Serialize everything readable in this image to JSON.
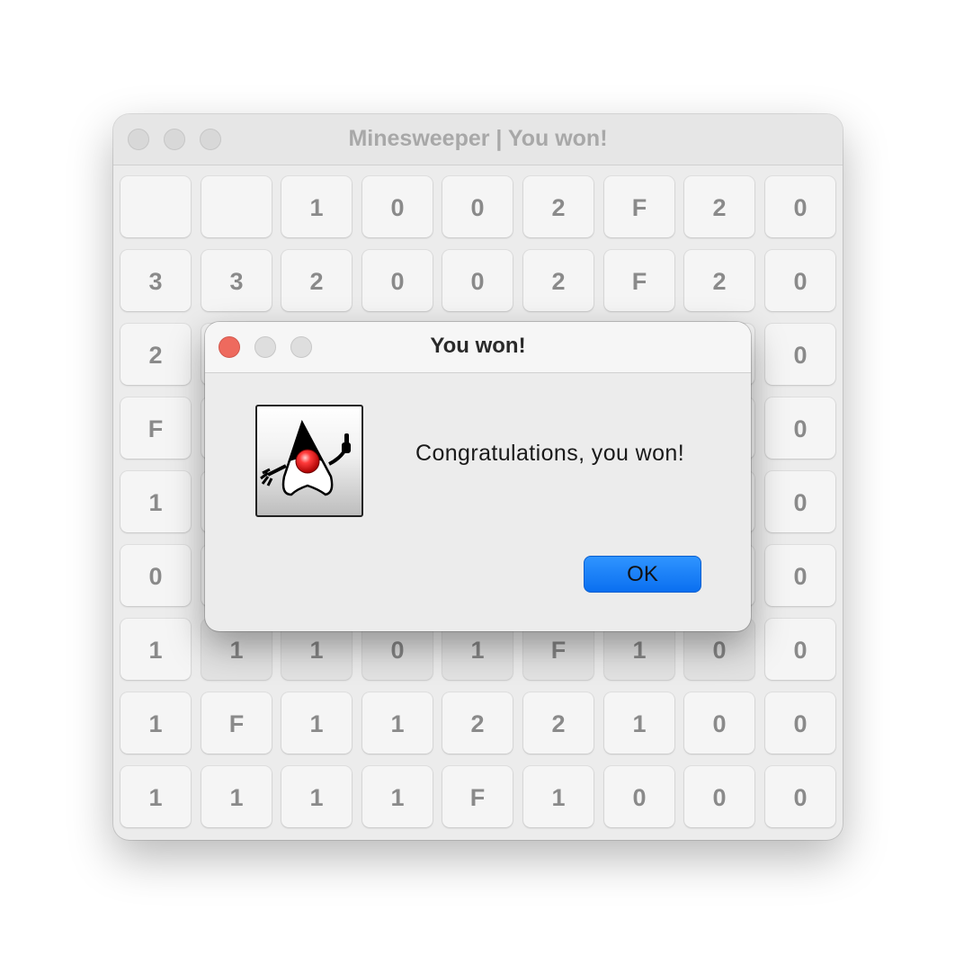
{
  "main_window": {
    "title": "Minesweeper | You won!",
    "grid": [
      [
        "",
        "",
        "1",
        "0",
        "0",
        "2",
        "F",
        "2",
        "0"
      ],
      [
        "3",
        "3",
        "2",
        "0",
        "0",
        "2",
        "F",
        "2",
        "0"
      ],
      [
        "2",
        "",
        "",
        "",
        "",
        "",
        "",
        "",
        "0"
      ],
      [
        "F",
        "",
        "",
        "",
        "",
        "",
        "",
        "",
        "0"
      ],
      [
        "1",
        "",
        "",
        "",
        "",
        "",
        "",
        "",
        "0"
      ],
      [
        "0",
        "",
        "",
        "",
        "",
        "",
        "",
        "",
        "0"
      ],
      [
        "1",
        "1",
        "1",
        "0",
        "1",
        "F",
        "1",
        "0",
        "0"
      ],
      [
        "1",
        "F",
        "1",
        "1",
        "2",
        "2",
        "1",
        "0",
        "0"
      ],
      [
        "1",
        "1",
        "1",
        "1",
        "F",
        "1",
        "0",
        "0",
        "0"
      ]
    ]
  },
  "dialog": {
    "title": "You won!",
    "icon": "java-duke-icon",
    "message": "Congratulations, you won!",
    "ok_label": "OK",
    "ok_color": "#0a6ff0",
    "close_color": "#ee6a5e"
  }
}
